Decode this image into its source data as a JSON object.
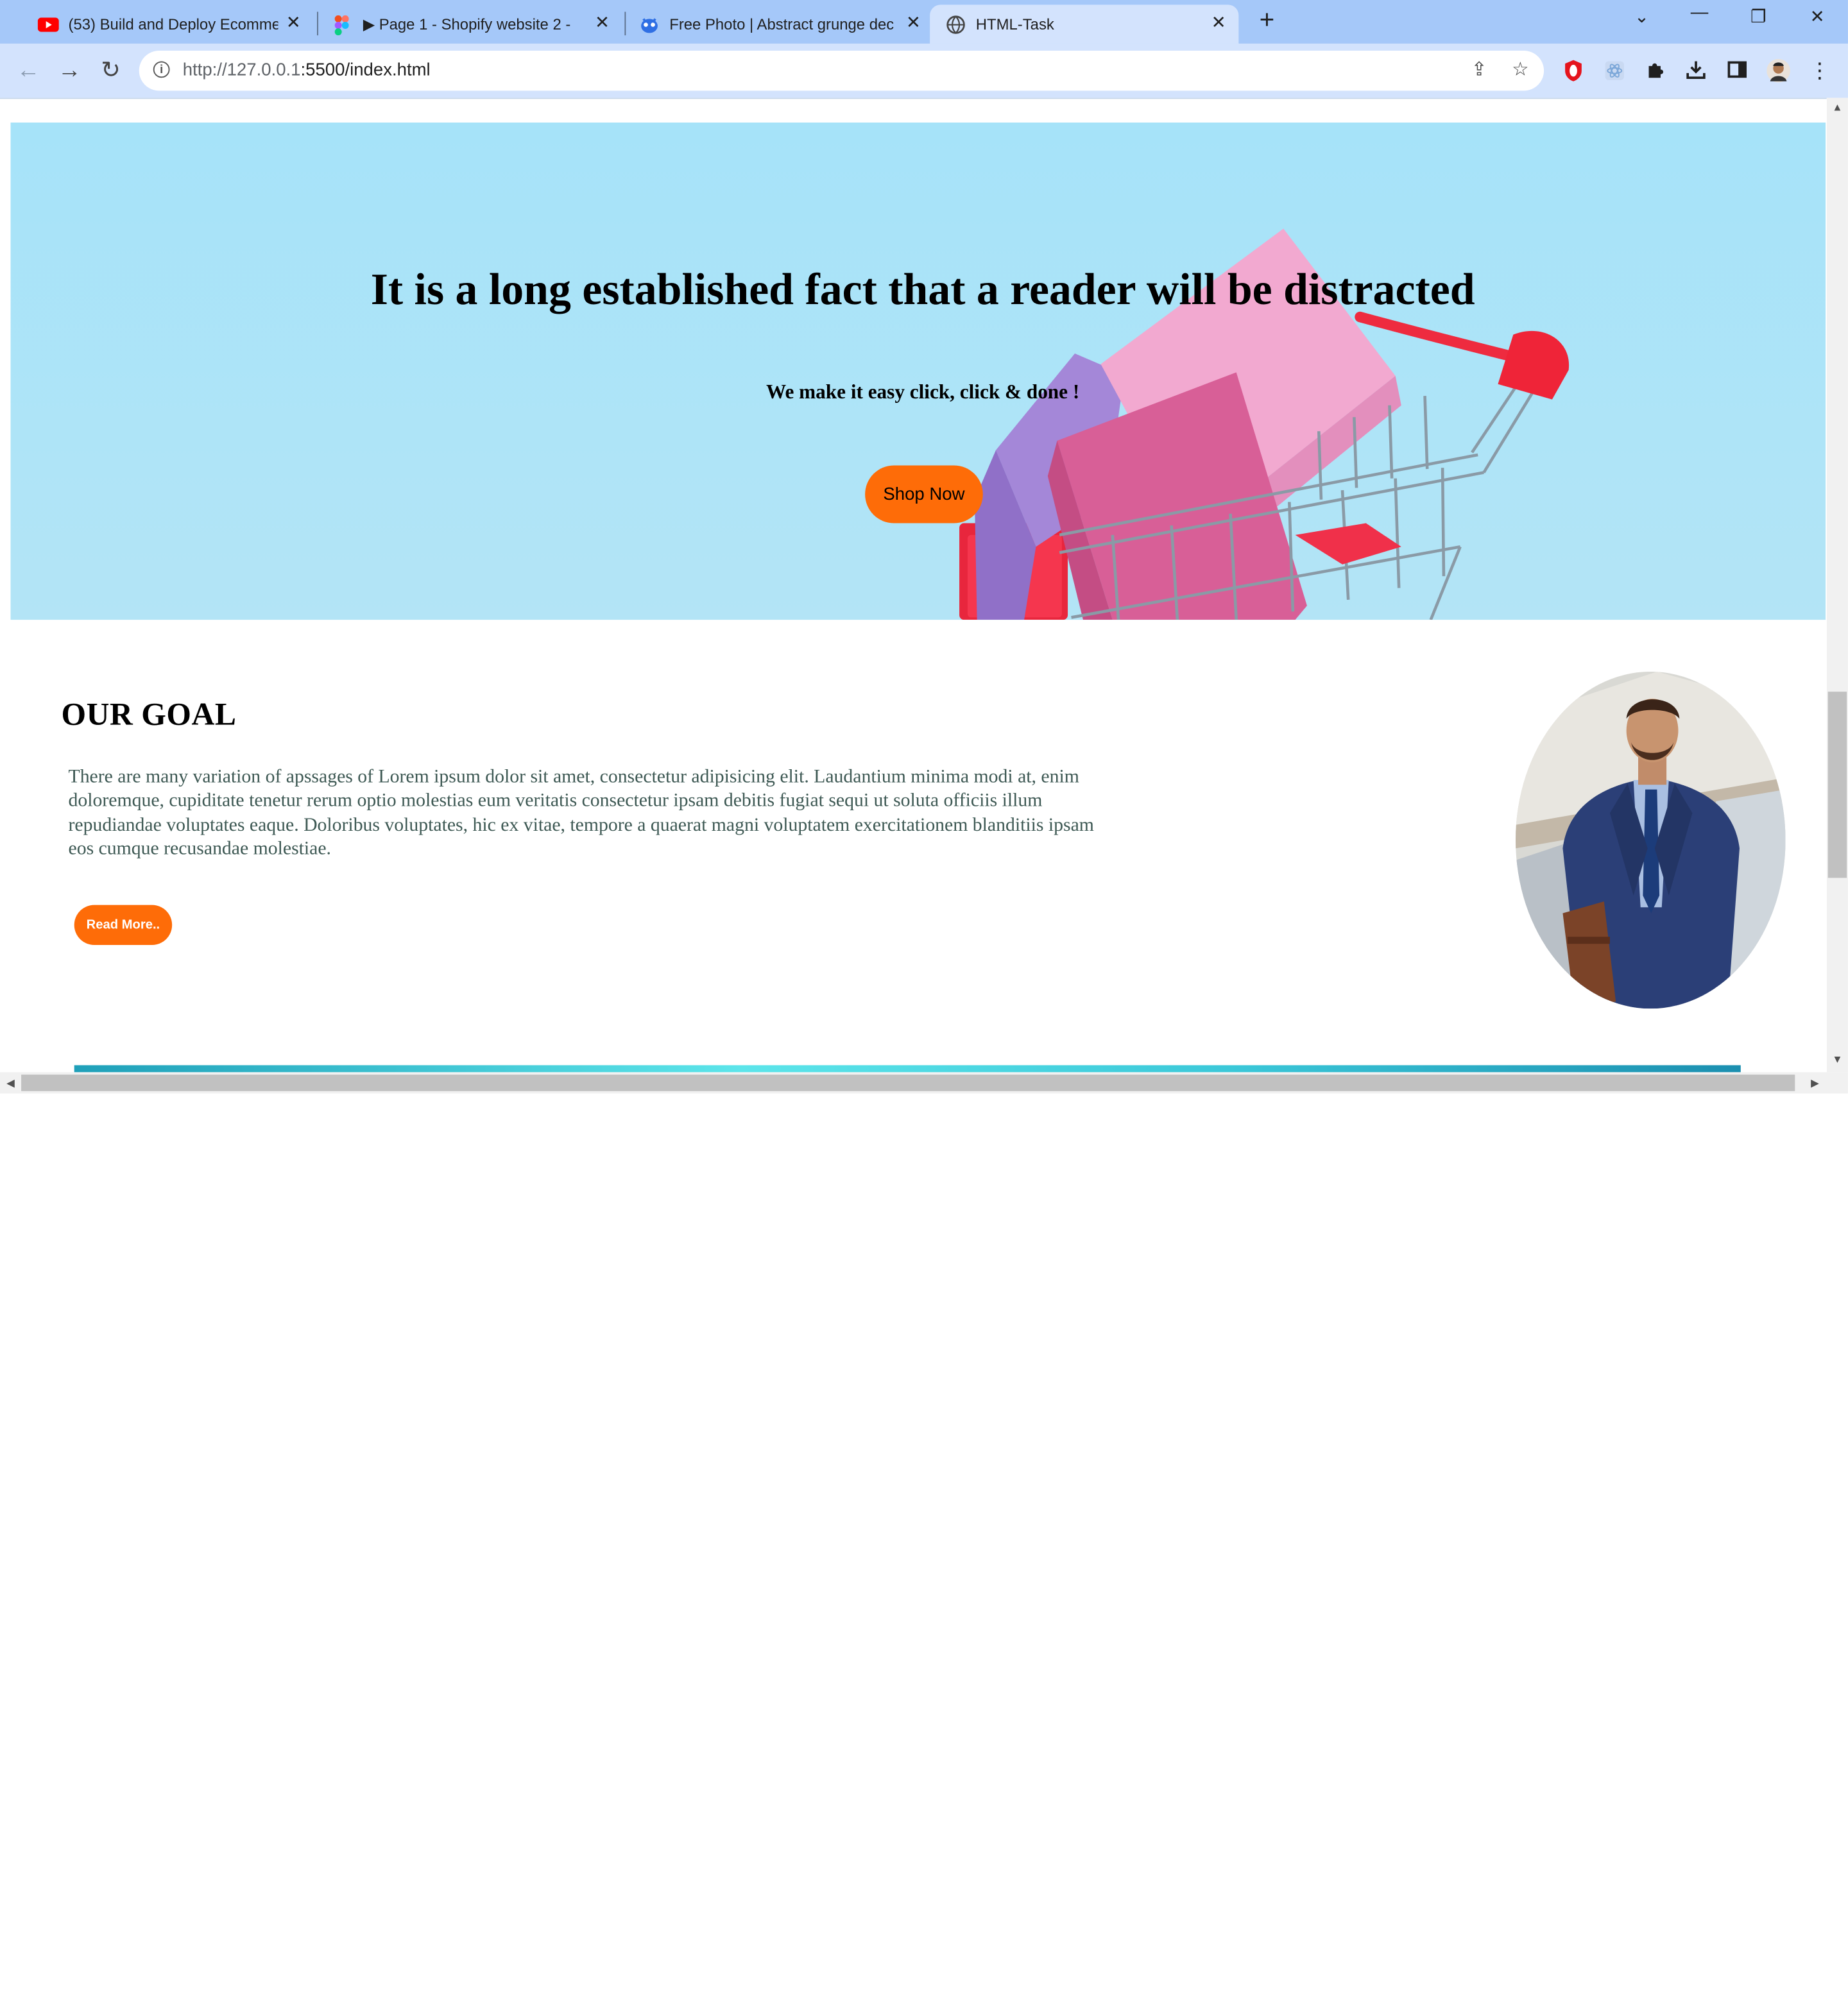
{
  "browser": {
    "tabs": [
      {
        "title": "(53) Build and Deploy Ecommerce",
        "icon": "youtube-icon"
      },
      {
        "title": "▶ Page 1 - Shopify website 2 - 1",
        "icon": "figma-icon"
      },
      {
        "title": "Free Photo | Abstract grunge dec",
        "icon": "freepik-icon"
      },
      {
        "title": "HTML-Task",
        "icon": "globe-icon",
        "active": true
      }
    ],
    "new_tab_label": "+",
    "url_host": "http://127.0.0.1",
    "url_rest": ":5500/index.html"
  },
  "hero": {
    "title": "It is a long established fact that a reader will be distracted",
    "subtitle": "We make it easy click, click & done !",
    "cta_label": "Shop Now"
  },
  "goal": {
    "title": "OUR GOAL",
    "text": "There are many variation of apssages of Lorem ipsum dolor sit amet, consectetur adipisicing elit. Laudantium minima modi at, enim doloremque, cupiditate tenetur rerum optio molestias eum veritatis consectetur ipsam debitis fugiat sequi ut soluta officiis illum repudiandae voluptates eaque. Doloribus voluptates, hic ex vitae, tempore a quaerat magni voluptatem exercitationem blanditiis ipsam eos cumque recusandae molestiae.",
    "read_more_label": "Read More.."
  },
  "colors": {
    "accent_orange": "#fe6c08",
    "hero_sky": "#a4e2f8",
    "tab_strip": "#a5c8f9",
    "toolbar": "#d3e3fd"
  }
}
